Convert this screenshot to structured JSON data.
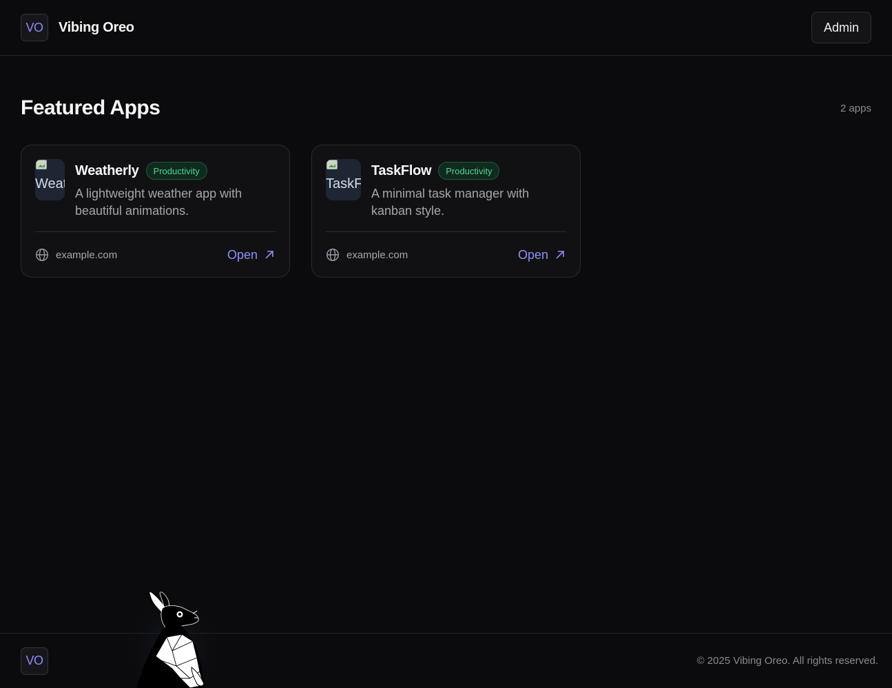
{
  "header": {
    "logo_initials": "VO",
    "brand_name": "Vibing Oreo",
    "admin_label": "Admin"
  },
  "section": {
    "title": "Featured Apps",
    "count_label": "2 apps"
  },
  "apps": [
    {
      "name": "Weatherly",
      "icon_alt": "Weatherly",
      "category": "Productivity",
      "description": "A lightweight weather app with beautiful animations.",
      "domain": "example.com",
      "open_label": "Open"
    },
    {
      "name": "TaskFlow",
      "icon_alt": "TaskFlow",
      "category": "Productivity",
      "description": "A minimal task manager with kanban style.",
      "domain": "example.com",
      "open_label": "Open"
    }
  ],
  "footer": {
    "logo_initials": "VO",
    "copyright": "© 2025 Vibing Oreo. All rights reserved."
  },
  "colors": {
    "background": "#0b0b0d",
    "accent": "#8e90fa",
    "badge_text": "#55d38e",
    "card_border": "#2a2a30"
  },
  "icons": [
    "globe-icon",
    "arrow-up-right-icon",
    "broken-image-icon",
    "rabbit-mascot"
  ]
}
